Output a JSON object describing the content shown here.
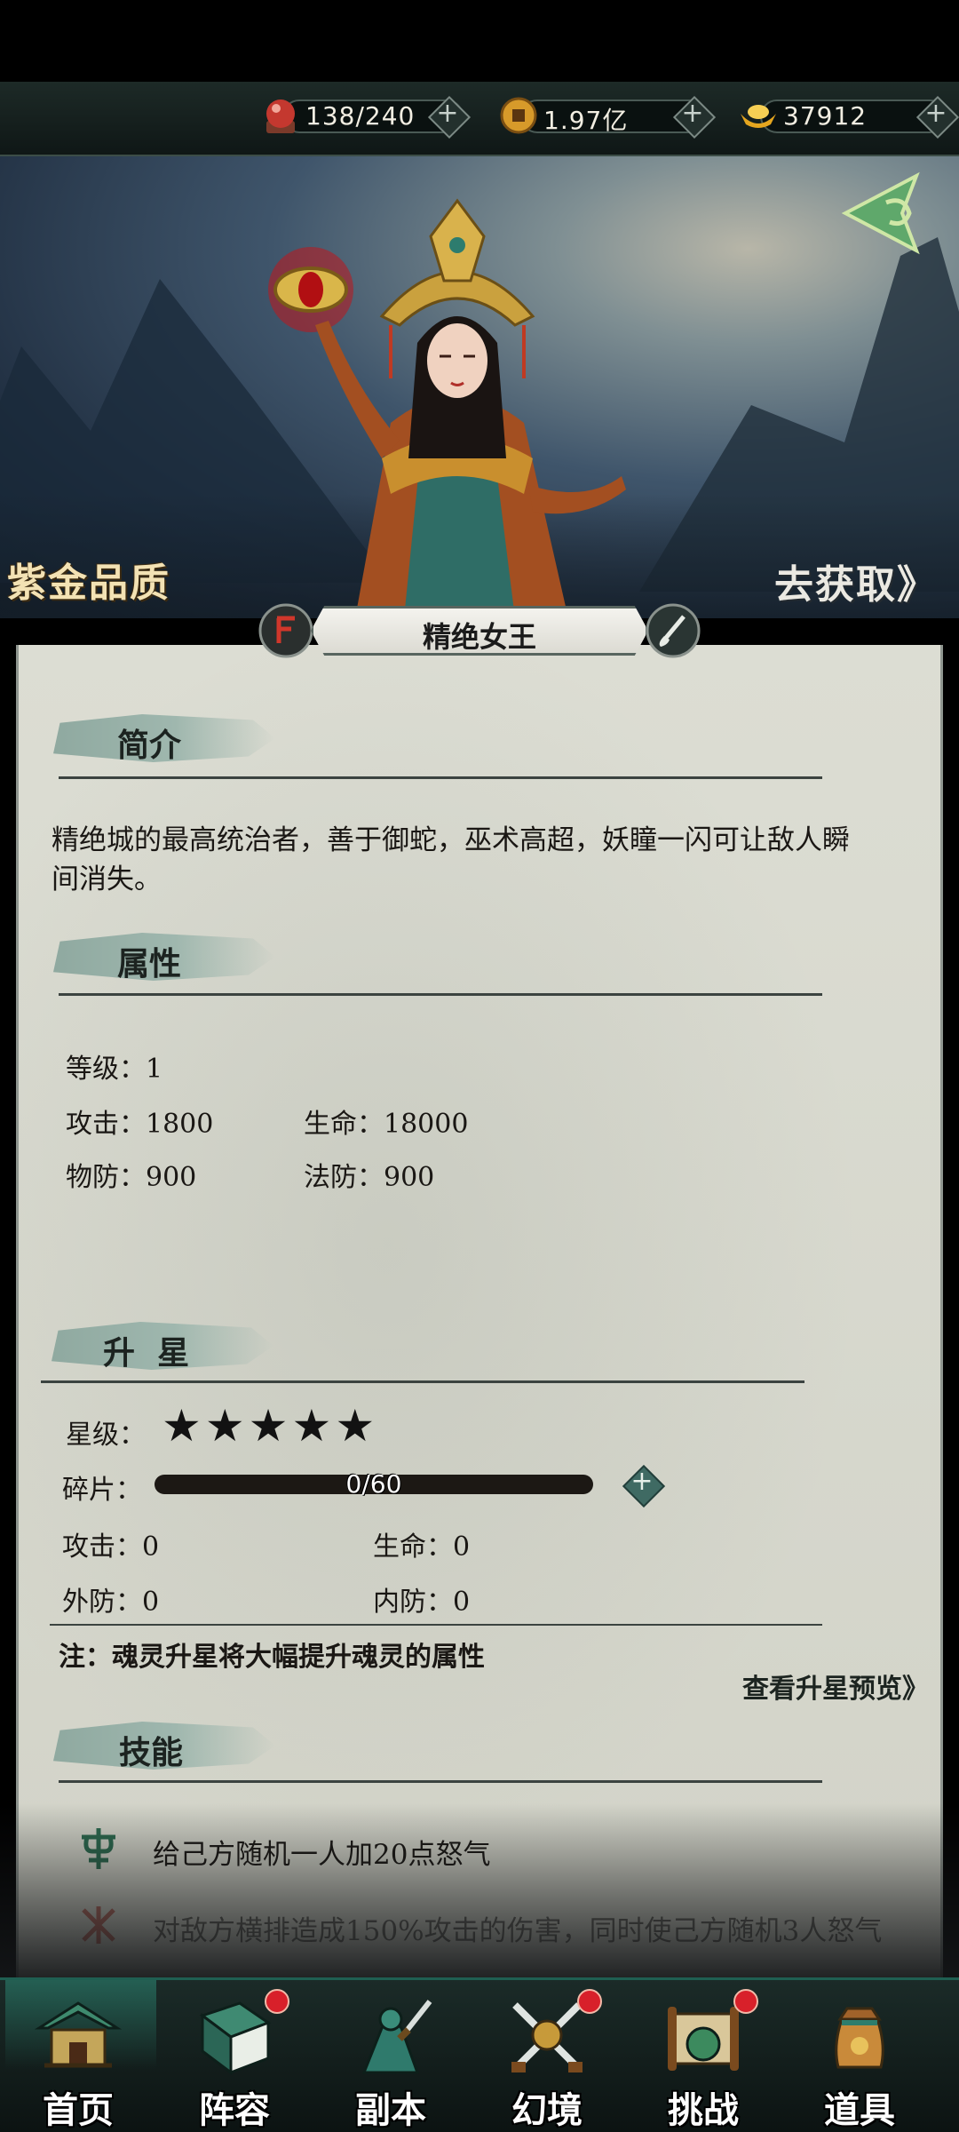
{
  "resources": [
    {
      "icon": "stamina-orb-icon",
      "value": "138/240"
    },
    {
      "icon": "copper-coin-icon",
      "value": "1.97亿"
    },
    {
      "icon": "gold-ingot-icon",
      "value": "37912"
    }
  ],
  "banner": {
    "quality_label": "紫金品质",
    "obtain_label": "去获取》"
  },
  "hero": {
    "name": "精绝女王"
  },
  "sections": {
    "intro_title": "简介",
    "attributes_title": "属性",
    "star_title": "升  星",
    "skills_title": "技能"
  },
  "intro": {
    "text": "精绝城的最高统治者，善于御蛇，巫术高超，妖瞳一闪可让敌人瞬间消失。"
  },
  "attributes": {
    "level": "等级：1",
    "attack": "攻击：1800",
    "hp": "生命：18000",
    "phys_def": "物防：900",
    "magic_def": "法防：900"
  },
  "star_up": {
    "star_label": "星级：",
    "stars": 5,
    "shard_label": "碎片：",
    "shard_value": "0/60",
    "shard_progress": 0,
    "attack": "攻击：0",
    "hp": "生命：0",
    "outer_def": "外防：0",
    "inner_def": "内防：0",
    "note": "注：魂灵升星将大幅提升魂灵的属性",
    "preview_link": "查看升星预览》"
  },
  "skills": [
    {
      "icon": "skill-band-icon",
      "text": "给己方随机一人加20点怒气"
    },
    {
      "icon": "skill-rage-icon",
      "text": "对敌方横排造成150%攻击的伤害，同时使己方随机3人怒气"
    }
  ],
  "nav": [
    {
      "key": "home",
      "label": "首页",
      "badge": false,
      "active": true
    },
    {
      "key": "lineup",
      "label": "阵容",
      "badge": true,
      "active": false
    },
    {
      "key": "dungeon",
      "label": "副本",
      "badge": false,
      "active": false
    },
    {
      "key": "illusion",
      "label": "幻境",
      "badge": true,
      "active": false
    },
    {
      "key": "challenge",
      "label": "挑战",
      "badge": true,
      "active": false
    },
    {
      "key": "items",
      "label": "道具",
      "badge": false,
      "active": false
    }
  ],
  "colors": {
    "accent_teal": "#3f6a63",
    "badge_red": "#d8202a",
    "panel_bg": "#d6d7cc"
  }
}
